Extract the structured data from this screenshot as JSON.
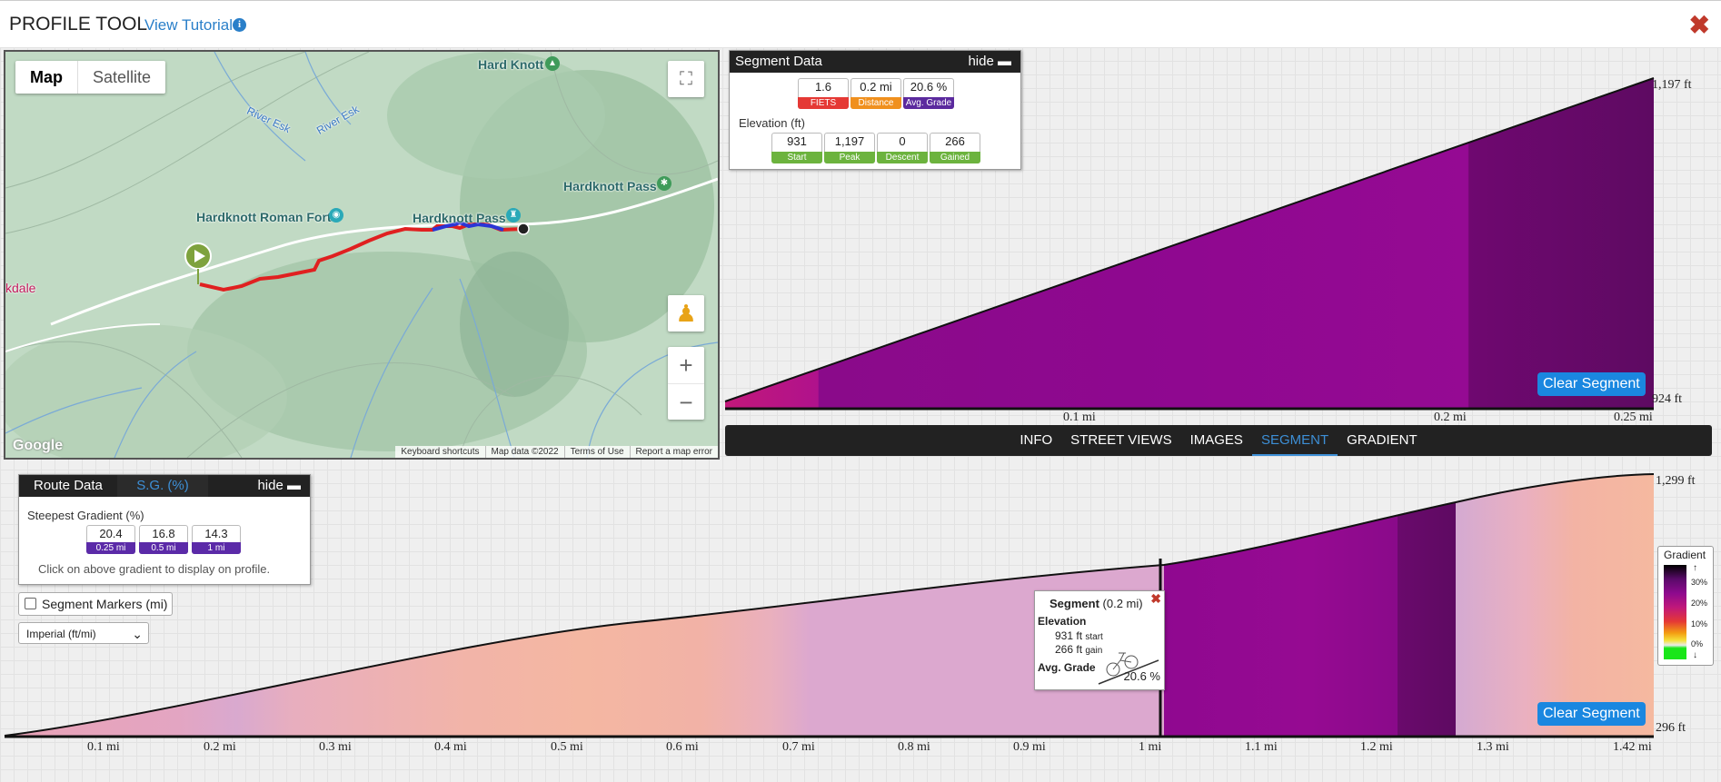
{
  "header": {
    "title": "PROFILE TOOL",
    "tutorial_link": "View Tutorial",
    "info_icon": "info-icon",
    "close_icon": "close-icon"
  },
  "map": {
    "type_map": "Map",
    "type_satellite": "Satellite",
    "labels": {
      "hard_knott": "Hard Knott",
      "hardknott_pass_right": "Hardknott Pass",
      "hardknott_roman_fort": "Hardknott Roman Fort",
      "hardknott_pass_route": "Hardknott Pass",
      "eskdale": "kdale",
      "river_esk_1": "River Esk",
      "river_esk_2": "River Esk"
    },
    "google": "Google",
    "attribution": [
      "Keyboard shortcuts",
      "Map data ©2022",
      "Terms of Use",
      "Report a map error"
    ],
    "zoom_in": "+",
    "zoom_out": "−"
  },
  "segment_panel": {
    "title": "Segment Data",
    "hide": "hide",
    "stats": [
      {
        "value": "1.6",
        "label": "FIETS",
        "color": "#e53935"
      },
      {
        "value": "0.2 mi",
        "label": "Distance",
        "color": "#f0901e"
      },
      {
        "value": "20.6 %",
        "label": "Avg. Grade",
        "color": "#5b2a9e"
      }
    ],
    "elevation_title": "Elevation (ft)",
    "elevation_stats": [
      {
        "value": "931",
        "label": "Start"
      },
      {
        "value": "1,197",
        "label": "Peak"
      },
      {
        "value": "0",
        "label": "Descent"
      },
      {
        "value": "266",
        "label": "Gained"
      }
    ],
    "stat_green": "#6cb33e"
  },
  "top_chart": {
    "ymax_label": "1,197 ft",
    "ymin_label": "924 ft",
    "x_ticks": [
      "0.1 mi",
      "0.2 mi",
      "0.25 mi"
    ],
    "clear_button": "Clear Segment"
  },
  "tabs": [
    "INFO",
    "STREET VIEWS",
    "IMAGES",
    "SEGMENT",
    "GRADIENT"
  ],
  "active_tab": "SEGMENT",
  "route_panel": {
    "title": "Route Data",
    "sg_tab": "S.G. (%)",
    "hide": "hide",
    "steepest_title": "Steepest Gradient (%)",
    "steepest": [
      {
        "value": "20.4",
        "label": "0.25 mi"
      },
      {
        "value": "16.8",
        "label": "0.5 mi"
      },
      {
        "value": "14.3",
        "label": "1 mi"
      }
    ],
    "hint": "Click on above gradient to display on profile.",
    "label_color": "#5b2aa8"
  },
  "segment_markers": "Segment Markers (mi)",
  "units_select": "Imperial (ft/mi)",
  "bottom_chart": {
    "ymax_label": "1,299 ft",
    "ymin_label": "296 ft",
    "x_ticks": [
      "0.1 mi",
      "0.2 mi",
      "0.3 mi",
      "0.4 mi",
      "0.5 mi",
      "0.6 mi",
      "0.7 mi",
      "0.8 mi",
      "0.9 mi",
      "1 mi",
      "1.1 mi",
      "1.2 mi",
      "1.3 mi",
      "1.42 mi"
    ],
    "clear_button": "Clear Segment"
  },
  "tooltip": {
    "title": "Segment",
    "distance": "(0.2 mi)",
    "elevation_label": "Elevation",
    "start_value": "931 ft",
    "start_word": "start",
    "gain_value": "266 ft",
    "gain_word": "gain",
    "grade_label": "Avg. Grade",
    "grade_value": "20.6 %",
    "bike_icon": "bicycle-icon",
    "close_icon": "close-icon"
  },
  "gradient_legend": {
    "title": "Gradient",
    "labels": [
      "30%",
      "20%",
      "10%",
      "0%"
    ],
    "up_arrow": "↑",
    "down_arrow": "↓"
  }
}
